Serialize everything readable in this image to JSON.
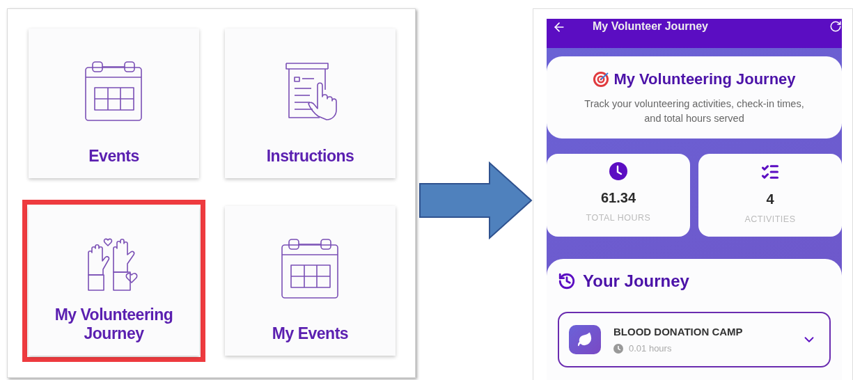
{
  "tiles": [
    {
      "label": "Events",
      "kind": "calendar",
      "highlighted": false
    },
    {
      "label": "Instructions",
      "kind": "document",
      "highlighted": false
    },
    {
      "label": "My Volunteering Journey",
      "kind": "hands",
      "highlighted": true
    },
    {
      "label": "My Events",
      "kind": "calendar",
      "highlighted": false
    }
  ],
  "phone": {
    "title": "My Volunteer Journey",
    "hero": {
      "title": "My Volunteering Journey",
      "subtitle": "Track your volunteering activities, check-in times, and total hours served"
    },
    "stats": [
      {
        "value": "61.34",
        "label": "TOTAL HOURS",
        "kind": "hours"
      },
      {
        "value": "4",
        "label": "ACTIVITIES",
        "kind": "activities"
      }
    ],
    "journey": {
      "title": "Your Journey",
      "activities": [
        {
          "name": "BLOOD DONATION CAMP",
          "hours": "0.01 hours",
          "expanded": false
        }
      ]
    }
  }
}
